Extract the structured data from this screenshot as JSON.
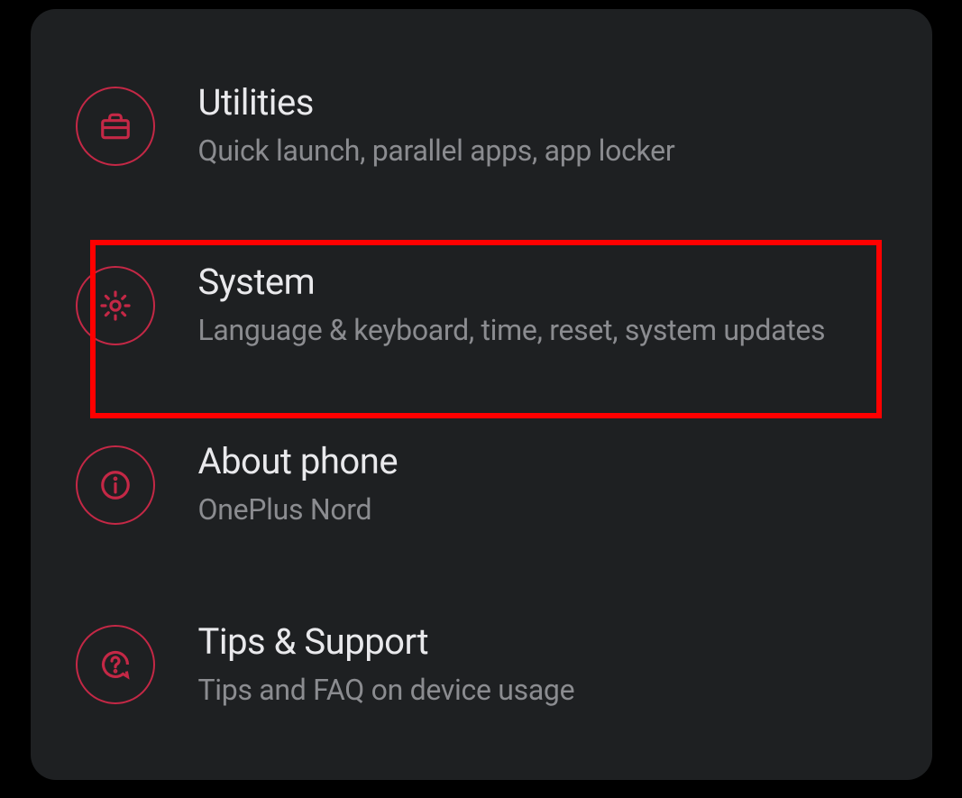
{
  "settings": {
    "items": [
      {
        "id": "utilities",
        "title": "Utilities",
        "subtitle": "Quick launch, parallel apps, app locker",
        "icon": "briefcase"
      },
      {
        "id": "system",
        "title": "System",
        "subtitle": "Language & keyboard, time, reset, system updates",
        "icon": "gear"
      },
      {
        "id": "about-phone",
        "title": "About phone",
        "subtitle": "OnePlus Nord",
        "icon": "info"
      },
      {
        "id": "tips-support",
        "title": "Tips & Support",
        "subtitle": "Tips and FAQ on device usage",
        "icon": "question"
      }
    ]
  },
  "highlighted_item_index": 1,
  "colors": {
    "accent": "#c42846",
    "highlight": "#ff0000",
    "bg": "#1e2022",
    "text_primary": "#e9e9ec",
    "text_secondary": "#8b8c90"
  }
}
